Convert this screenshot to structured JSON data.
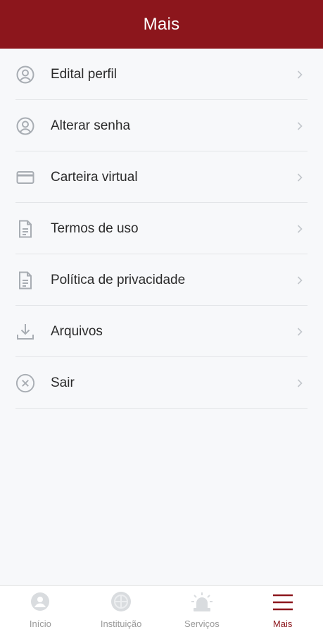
{
  "header": {
    "title": "Mais"
  },
  "menu": {
    "items": [
      {
        "label": "Edital perfil",
        "icon": "user-circle-icon"
      },
      {
        "label": "Alterar senha",
        "icon": "user-circle-icon"
      },
      {
        "label": "Carteira virtual",
        "icon": "credit-card-icon"
      },
      {
        "label": "Termos de uso",
        "icon": "document-icon"
      },
      {
        "label": "Política de privacidade",
        "icon": "document-icon"
      },
      {
        "label": "Arquivos",
        "icon": "download-icon"
      },
      {
        "label": "Sair",
        "icon": "close-circle-icon"
      }
    ]
  },
  "bottom_nav": {
    "items": [
      {
        "label": "Início",
        "icon": "home-icon",
        "active": false
      },
      {
        "label": "Instituição",
        "icon": "institution-icon",
        "active": false
      },
      {
        "label": "Serviços",
        "icon": "services-icon",
        "active": false
      },
      {
        "label": "Mais",
        "icon": "menu-icon",
        "active": true
      }
    ]
  },
  "colors": {
    "brand": "#8c161c",
    "background": "#f7f8fa",
    "icon_gray": "#a8adb3"
  }
}
